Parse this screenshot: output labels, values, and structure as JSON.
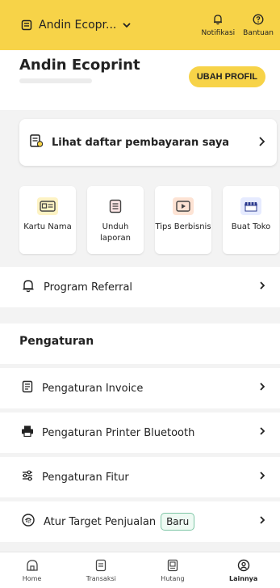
{
  "topbar": {
    "store_name": "Andin Ecopr...",
    "notif_label": "Notifikasi",
    "help_label": "Bantuan"
  },
  "profile": {
    "name": "Andin Ecoprint",
    "edit_button": "UBAH PROFIL"
  },
  "payment": {
    "label": "Lihat daftar pembayaran saya"
  },
  "tiles": [
    {
      "label": "Kartu Nama"
    },
    {
      "label": "Unduh laporan"
    },
    {
      "label": "Tips Berbisnis"
    },
    {
      "label": "Buat Toko"
    }
  ],
  "referral": {
    "label": "Program Referral"
  },
  "settings": {
    "title": "Pengaturan",
    "items": [
      {
        "label": "Pengaturan Invoice"
      },
      {
        "label": "Pengaturan Printer Bluetooth"
      },
      {
        "label": "Pengaturan Fitur"
      },
      {
        "label": "Atur Target Penjualan",
        "badge": "Baru"
      }
    ]
  },
  "bottom_nav": [
    {
      "label": "Home"
    },
    {
      "label": "Transaksi"
    },
    {
      "label": "Hutang"
    },
    {
      "label": "Lainnya",
      "active": true
    }
  ],
  "colors": {
    "accent": "#f7d348",
    "badge_border": "#7fc6a6"
  }
}
